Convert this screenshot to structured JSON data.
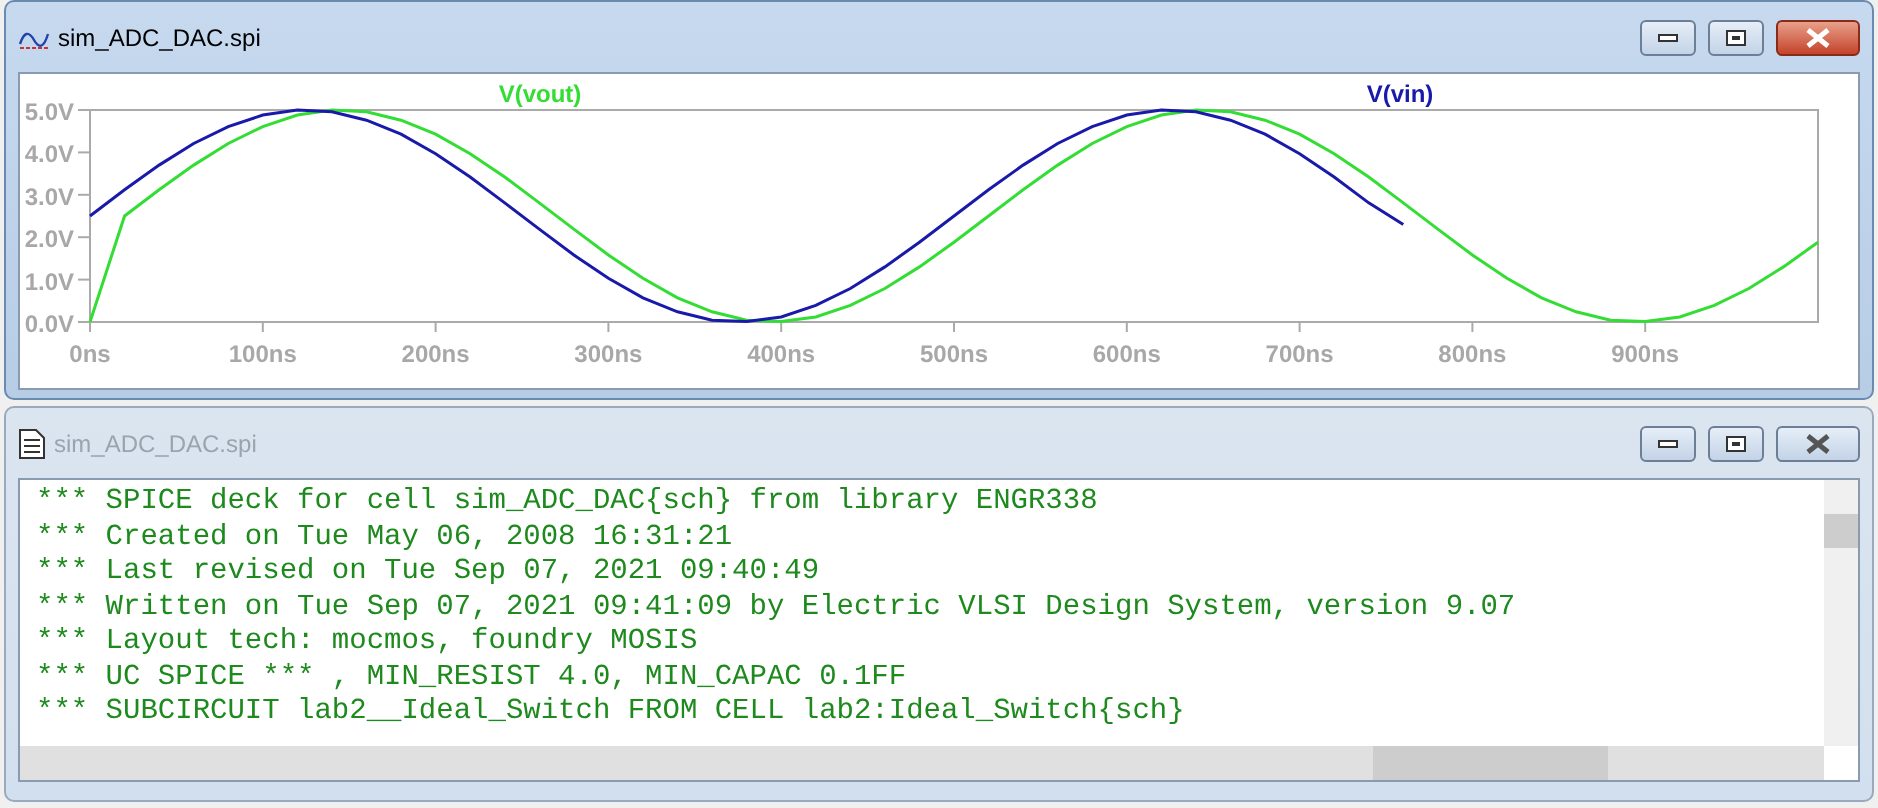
{
  "windows": [
    {
      "kind": "plot",
      "title": "sim_ADC_DAC.spi",
      "active": true,
      "chart_data": {
        "type": "line",
        "x": [
          0,
          20,
          40,
          60,
          80,
          100,
          120,
          140,
          160,
          180,
          200,
          220,
          240,
          260,
          280,
          300,
          320,
          340,
          360,
          380,
          400,
          420,
          440,
          460,
          480,
          500,
          520,
          540,
          560,
          580,
          600,
          620,
          640,
          660,
          680,
          700,
          720,
          740,
          760,
          780,
          800,
          820,
          840,
          860,
          880,
          900,
          920,
          940,
          960,
          980,
          1000
        ],
        "series": [
          {
            "name": "V(vout)",
            "color": "#33dd33",
            "values": [
              0,
              2.5,
              3.12,
              3.7,
              4.21,
              4.61,
              4.88,
              5.0,
              4.96,
              4.76,
              4.43,
              3.97,
              3.42,
              2.81,
              2.19,
              1.58,
              1.03,
              0.57,
              0.24,
              0.04,
              0.01,
              0.12,
              0.39,
              0.79,
              1.3,
              1.88,
              2.5,
              3.12,
              3.7,
              4.21,
              4.61,
              4.88,
              5.0,
              4.96,
              4.76,
              4.43,
              3.97,
              3.42,
              2.81,
              2.19,
              1.58,
              1.03,
              0.57,
              0.24,
              0.04,
              0.01,
              0.12,
              0.39,
              0.79,
              1.3,
              1.88
            ]
          },
          {
            "name": "V(vin)",
            "color": "#1a1aaa",
            "values": [
              2.5,
              3.12,
              3.7,
              4.21,
              4.61,
              4.88,
              5.0,
              4.96,
              4.76,
              4.43,
              3.97,
              3.42,
              2.81,
              2.19,
              1.58,
              1.03,
              0.57,
              0.24,
              0.04,
              0.01,
              0.12,
              0.39,
              0.79,
              1.3,
              1.88,
              2.5,
              3.12,
              3.7,
              4.21,
              4.61,
              4.88,
              5.0,
              4.96,
              4.76,
              4.43,
              3.97,
              3.42,
              2.81,
              2.3,
              null,
              null,
              null,
              null,
              null,
              null,
              null,
              null,
              null,
              null,
              null,
              null
            ]
          }
        ],
        "xlim": [
          0,
          1000
        ],
        "ylim": [
          0,
          5
        ],
        "xticks": [
          {
            "value": 0,
            "label": "0ns"
          },
          {
            "value": 100,
            "label": "100ns"
          },
          {
            "value": 200,
            "label": "200ns"
          },
          {
            "value": 300,
            "label": "300ns"
          },
          {
            "value": 400,
            "label": "400ns"
          },
          {
            "value": 500,
            "label": "500ns"
          },
          {
            "value": 600,
            "label": "600ns"
          },
          {
            "value": 700,
            "label": "700ns"
          },
          {
            "value": 800,
            "label": "800ns"
          },
          {
            "value": 900,
            "label": "900ns"
          }
        ],
        "yticks": [
          {
            "value": 0,
            "label": "0.0V"
          },
          {
            "value": 1,
            "label": "1.0V"
          },
          {
            "value": 2,
            "label": "2.0V"
          },
          {
            "value": 3,
            "label": "3.0V"
          },
          {
            "value": 4,
            "label": "4.0V"
          },
          {
            "value": 5,
            "label": "5.0V"
          }
        ]
      }
    },
    {
      "kind": "text",
      "title": "sim_ADC_DAC.spi",
      "active": false,
      "lines": [
        "*** SPICE deck for cell sim_ADC_DAC{sch} from library ENGR338",
        "*** Created on Tue May 06, 2008 16:31:21",
        "*** Last revised on Tue Sep 07, 2021 09:40:49",
        "*** Written on Tue Sep 07, 2021 09:41:09 by Electric VLSI Design System, version 9.07",
        "*** Layout tech: mocmos, foundry MOSIS",
        "*** UC SPICE *** , MIN_RESIST 4.0, MIN_CAPAC 0.1FF",
        "*** SUBCIRCUIT lab2__Ideal_Switch FROM CELL lab2:Ideal_Switch{sch}"
      ]
    }
  ]
}
